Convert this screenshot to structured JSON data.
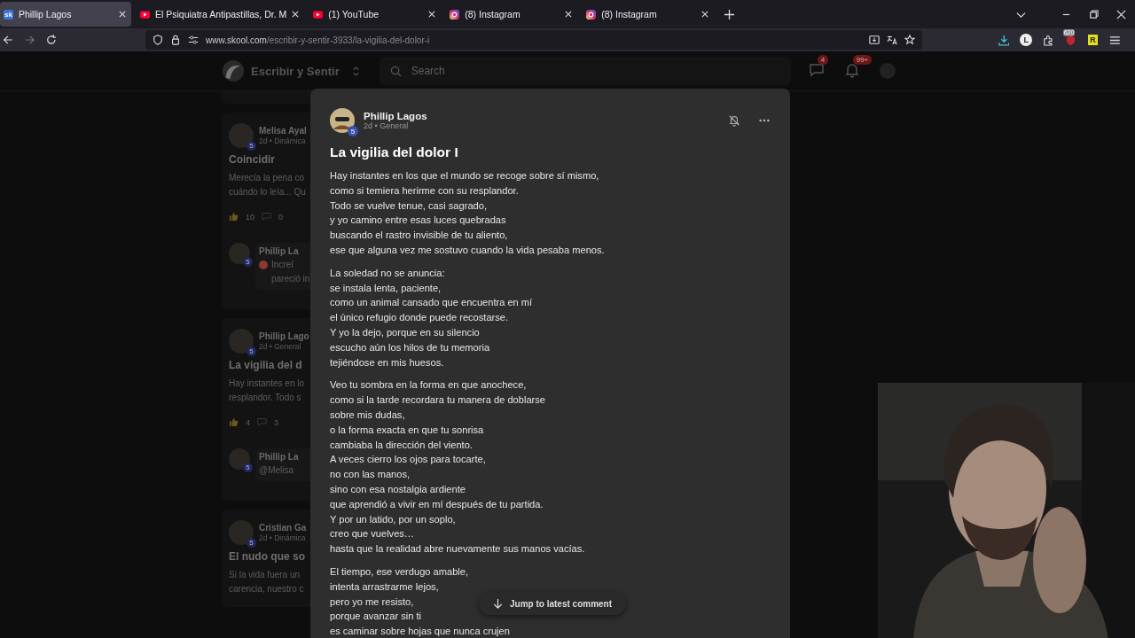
{
  "browser": {
    "tabs": [
      {
        "kind": "skool",
        "favicon": "sk",
        "title": "Phillip Lagos",
        "selected": true
      },
      {
        "kind": "youtube",
        "title": "El Psiquiatra Antipastillas, Dr. M",
        "selected": false
      },
      {
        "kind": "youtube",
        "title": "(1) YouTube",
        "selected": false
      },
      {
        "kind": "instagram",
        "title": "(8) Instagram",
        "selected": false
      },
      {
        "kind": "instagram",
        "title": "(8) Instagram",
        "selected": false
      }
    ],
    "url": {
      "domain": "www.skool.com",
      "path": "/escribir-y-sentir-3933/la-vigilia-del-dolor-i"
    },
    "extensions": [
      {
        "kind": "download"
      },
      {
        "kind": "circle-letter",
        "text": "L"
      },
      {
        "kind": "puzzle"
      },
      {
        "kind": "badge",
        "text": "620"
      },
      {
        "kind": "square-letter",
        "text": "R"
      }
    ]
  },
  "community": {
    "name": "Escribir y Sentir",
    "search_placeholder": "Search",
    "chat_badge": "4",
    "notification_badge": "99+"
  },
  "feed": [
    {
      "author": "Melisa Ayal",
      "level_badge": "5",
      "meta": "2d • Dinámica",
      "title": "Coincidir",
      "excerpt": "Merecía la pena co\ncuándo lo leía... Qu",
      "likes": "10",
      "comments": "0",
      "reply": {
        "author": "Phillip La",
        "level_badge": "5",
        "text": "Increí\npareció in",
        "emoji": true
      }
    },
    {
      "author": "Phillip Lago",
      "level_badge": "5",
      "meta": "2d • General",
      "title": "La vigilia del d",
      "excerpt": "Hay instantes en lo\nresplandor. Todo s",
      "likes": "4",
      "comments": "3",
      "reply": {
        "author": "Phillip La",
        "level_badge": "5",
        "text": "@Melisa",
        "emoji": false
      }
    },
    {
      "author": "Cristian Ga",
      "level_badge": "5",
      "meta": "2d • Dinámica",
      "title": "El nudo que so",
      "excerpt": "Si la vida fuera un\ncarencia, nuestro c"
    }
  ],
  "post": {
    "author": "Phillip Lagos",
    "level_badge": "5",
    "meta": "2d • General",
    "title": "La vigilia del dolor I",
    "stanzas": [
      [
        "Hay instantes en los que el mundo se recoge sobre sí mismo,",
        "como si temiera herirme con su resplandor.",
        "Todo se vuelve tenue, casi sagrado,",
        "y yo camino entre esas luces quebradas",
        "buscando el rastro invisible de tu aliento,",
        "ese que alguna vez me sostuvo cuando la vida pesaba menos."
      ],
      [
        "La soledad no se anuncia:",
        "se instala lenta, paciente,",
        "como un animal cansado que encuentra en mí",
        "el único refugio donde puede recostarse.",
        "Y yo la dejo, porque en su silencio",
        "escucho aún los hilos de tu memoria",
        "tejiéndose en mis huesos."
      ],
      [
        "Veo tu sombra en la forma en que anochece,",
        "como si la tarde recordara tu manera de doblarse",
        "sobre mis dudas,",
        "o la forma exacta en que tu sonrisa",
        "cambiaba la dirección del viento.",
        "A veces cierro los ojos para tocarte,",
        "no con las manos,",
        "sino con esa nostalgia ardiente",
        "que aprendió a vivir en mí después de tu partida.",
        "Y por un latido, por un soplo,",
        "creo que vuelves…",
        "hasta que la realidad abre nuevamente sus manos vacías."
      ],
      [
        "El tiempo, ese verdugo amable,",
        "intenta arrastrarme lejos,",
        "pero yo me resisto,",
        "porque avanzar sin ti",
        "es caminar sobre hojas que nunca crujen"
      ]
    ],
    "jump_button": "Jump to latest comment"
  }
}
